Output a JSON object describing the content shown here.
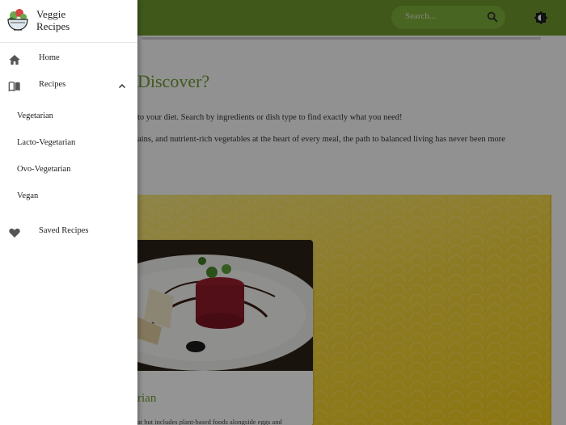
{
  "app": {
    "brand_line1": "Veggie",
    "brand_line2": "Recipes",
    "search_placeholder": "Search...",
    "accent_color": "#6e9a2f"
  },
  "drawer": {
    "items": [
      {
        "label": "Home",
        "icon": "home-icon"
      },
      {
        "label": "Recipes",
        "icon": "menu-book-icon",
        "expanded": true
      },
      {
        "label": "Saved Recipes",
        "icon": "heart-icon"
      }
    ],
    "recipe_subitems": [
      "Vegetarian",
      "Lacto-Vegetarian",
      "Ovo-Vegetarian",
      "Vegan"
    ]
  },
  "main": {
    "title": "Discover?",
    "intro_line1": "to your diet. Search by ingredients or dish type to find exactly what you need!",
    "intro_line2": "ains, and nutrient-rich vegetables at the heart of every meal, the path to balanced living has never been more",
    "card": {
      "title": "rian",
      "text": "at but includes plant-based foods alongside eggs and"
    }
  }
}
